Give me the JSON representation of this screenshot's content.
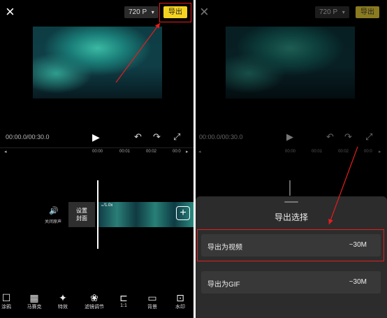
{
  "left": {
    "close_icon": "×",
    "resolution": "720 P",
    "resolution_caret": "▾",
    "export_label": "导出",
    "time_current": "00:00.0/00:30.0",
    "play_icon": "▶",
    "undo_icon": "↶",
    "redo_icon": "↷",
    "fullscreen_icon": "⤢",
    "ruler": [
      "00:00",
      "00:01",
      "00:02",
      "00:0"
    ],
    "mute_label": "关闭原声",
    "mute_icon": "🔊",
    "cover_label_1": "设置",
    "cover_label_2": "封面",
    "clip_speed": "1.0x",
    "add_icon": "+",
    "tools": [
      {
        "icon": "☐",
        "label": "涂鸦"
      },
      {
        "icon": "▦",
        "label": "马赛克"
      },
      {
        "icon": "✦",
        "label": "特效"
      },
      {
        "icon": "❀",
        "label": "滤镜调节"
      },
      {
        "icon": "⊏",
        "label": "1:1"
      },
      {
        "icon": "▭",
        "label": "背景"
      },
      {
        "icon": "⊡",
        "label": "水印"
      }
    ]
  },
  "right": {
    "close_icon": "×",
    "resolution": "720 P",
    "resolution_caret": "▾",
    "export_label": "导出",
    "time_current": "00:00.0/00:30.0",
    "play_icon": "▶",
    "undo_icon": "↶",
    "redo_icon": "↷",
    "fullscreen_icon": "⤢",
    "ruler": [
      "00:00",
      "00:01",
      "00:02",
      "00:0"
    ],
    "sheet_title": "导出选择",
    "options": [
      {
        "label": "导出为视频",
        "size": "~30M"
      },
      {
        "label": "导出为GIF",
        "size": "~30M"
      }
    ]
  },
  "colors": {
    "accent": "#f4d320",
    "highlight": "#e51d1d",
    "bg": "#000000"
  }
}
